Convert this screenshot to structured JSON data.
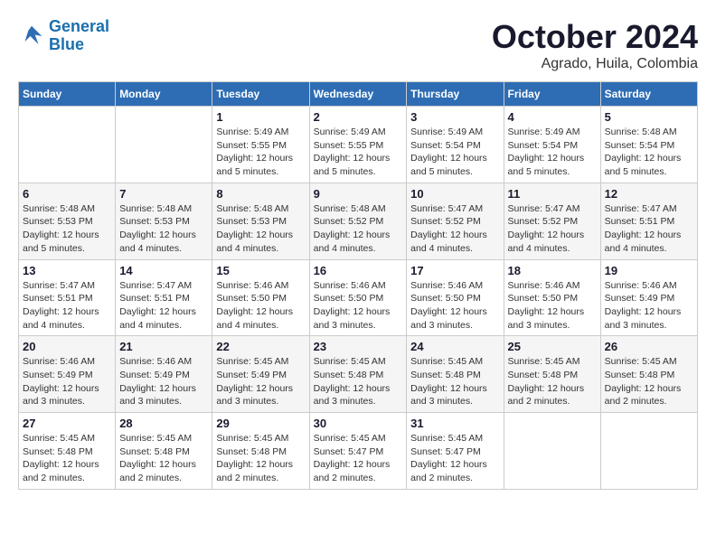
{
  "logo": {
    "line1": "General",
    "line2": "Blue"
  },
  "title": "October 2024",
  "subtitle": "Agrado, Huila, Colombia",
  "days_header": [
    "Sunday",
    "Monday",
    "Tuesday",
    "Wednesday",
    "Thursday",
    "Friday",
    "Saturday"
  ],
  "weeks": [
    [
      {
        "day": "",
        "sunrise": "",
        "sunset": "",
        "daylight": ""
      },
      {
        "day": "",
        "sunrise": "",
        "sunset": "",
        "daylight": ""
      },
      {
        "day": "1",
        "sunrise": "Sunrise: 5:49 AM",
        "sunset": "Sunset: 5:55 PM",
        "daylight": "Daylight: 12 hours and 5 minutes."
      },
      {
        "day": "2",
        "sunrise": "Sunrise: 5:49 AM",
        "sunset": "Sunset: 5:55 PM",
        "daylight": "Daylight: 12 hours and 5 minutes."
      },
      {
        "day": "3",
        "sunrise": "Sunrise: 5:49 AM",
        "sunset": "Sunset: 5:54 PM",
        "daylight": "Daylight: 12 hours and 5 minutes."
      },
      {
        "day": "4",
        "sunrise": "Sunrise: 5:49 AM",
        "sunset": "Sunset: 5:54 PM",
        "daylight": "Daylight: 12 hours and 5 minutes."
      },
      {
        "day": "5",
        "sunrise": "Sunrise: 5:48 AM",
        "sunset": "Sunset: 5:54 PM",
        "daylight": "Daylight: 12 hours and 5 minutes."
      }
    ],
    [
      {
        "day": "6",
        "sunrise": "Sunrise: 5:48 AM",
        "sunset": "Sunset: 5:53 PM",
        "daylight": "Daylight: 12 hours and 5 minutes."
      },
      {
        "day": "7",
        "sunrise": "Sunrise: 5:48 AM",
        "sunset": "Sunset: 5:53 PM",
        "daylight": "Daylight: 12 hours and 4 minutes."
      },
      {
        "day": "8",
        "sunrise": "Sunrise: 5:48 AM",
        "sunset": "Sunset: 5:53 PM",
        "daylight": "Daylight: 12 hours and 4 minutes."
      },
      {
        "day": "9",
        "sunrise": "Sunrise: 5:48 AM",
        "sunset": "Sunset: 5:52 PM",
        "daylight": "Daylight: 12 hours and 4 minutes."
      },
      {
        "day": "10",
        "sunrise": "Sunrise: 5:47 AM",
        "sunset": "Sunset: 5:52 PM",
        "daylight": "Daylight: 12 hours and 4 minutes."
      },
      {
        "day": "11",
        "sunrise": "Sunrise: 5:47 AM",
        "sunset": "Sunset: 5:52 PM",
        "daylight": "Daylight: 12 hours and 4 minutes."
      },
      {
        "day": "12",
        "sunrise": "Sunrise: 5:47 AM",
        "sunset": "Sunset: 5:51 PM",
        "daylight": "Daylight: 12 hours and 4 minutes."
      }
    ],
    [
      {
        "day": "13",
        "sunrise": "Sunrise: 5:47 AM",
        "sunset": "Sunset: 5:51 PM",
        "daylight": "Daylight: 12 hours and 4 minutes."
      },
      {
        "day": "14",
        "sunrise": "Sunrise: 5:47 AM",
        "sunset": "Sunset: 5:51 PM",
        "daylight": "Daylight: 12 hours and 4 minutes."
      },
      {
        "day": "15",
        "sunrise": "Sunrise: 5:46 AM",
        "sunset": "Sunset: 5:50 PM",
        "daylight": "Daylight: 12 hours and 4 minutes."
      },
      {
        "day": "16",
        "sunrise": "Sunrise: 5:46 AM",
        "sunset": "Sunset: 5:50 PM",
        "daylight": "Daylight: 12 hours and 3 minutes."
      },
      {
        "day": "17",
        "sunrise": "Sunrise: 5:46 AM",
        "sunset": "Sunset: 5:50 PM",
        "daylight": "Daylight: 12 hours and 3 minutes."
      },
      {
        "day": "18",
        "sunrise": "Sunrise: 5:46 AM",
        "sunset": "Sunset: 5:50 PM",
        "daylight": "Daylight: 12 hours and 3 minutes."
      },
      {
        "day": "19",
        "sunrise": "Sunrise: 5:46 AM",
        "sunset": "Sunset: 5:49 PM",
        "daylight": "Daylight: 12 hours and 3 minutes."
      }
    ],
    [
      {
        "day": "20",
        "sunrise": "Sunrise: 5:46 AM",
        "sunset": "Sunset: 5:49 PM",
        "daylight": "Daylight: 12 hours and 3 minutes."
      },
      {
        "day": "21",
        "sunrise": "Sunrise: 5:46 AM",
        "sunset": "Sunset: 5:49 PM",
        "daylight": "Daylight: 12 hours and 3 minutes."
      },
      {
        "day": "22",
        "sunrise": "Sunrise: 5:45 AM",
        "sunset": "Sunset: 5:49 PM",
        "daylight": "Daylight: 12 hours and 3 minutes."
      },
      {
        "day": "23",
        "sunrise": "Sunrise: 5:45 AM",
        "sunset": "Sunset: 5:48 PM",
        "daylight": "Daylight: 12 hours and 3 minutes."
      },
      {
        "day": "24",
        "sunrise": "Sunrise: 5:45 AM",
        "sunset": "Sunset: 5:48 PM",
        "daylight": "Daylight: 12 hours and 3 minutes."
      },
      {
        "day": "25",
        "sunrise": "Sunrise: 5:45 AM",
        "sunset": "Sunset: 5:48 PM",
        "daylight": "Daylight: 12 hours and 2 minutes."
      },
      {
        "day": "26",
        "sunrise": "Sunrise: 5:45 AM",
        "sunset": "Sunset: 5:48 PM",
        "daylight": "Daylight: 12 hours and 2 minutes."
      }
    ],
    [
      {
        "day": "27",
        "sunrise": "Sunrise: 5:45 AM",
        "sunset": "Sunset: 5:48 PM",
        "daylight": "Daylight: 12 hours and 2 minutes."
      },
      {
        "day": "28",
        "sunrise": "Sunrise: 5:45 AM",
        "sunset": "Sunset: 5:48 PM",
        "daylight": "Daylight: 12 hours and 2 minutes."
      },
      {
        "day": "29",
        "sunrise": "Sunrise: 5:45 AM",
        "sunset": "Sunset: 5:48 PM",
        "daylight": "Daylight: 12 hours and 2 minutes."
      },
      {
        "day": "30",
        "sunrise": "Sunrise: 5:45 AM",
        "sunset": "Sunset: 5:47 PM",
        "daylight": "Daylight: 12 hours and 2 minutes."
      },
      {
        "day": "31",
        "sunrise": "Sunrise: 5:45 AM",
        "sunset": "Sunset: 5:47 PM",
        "daylight": "Daylight: 12 hours and 2 minutes."
      },
      {
        "day": "",
        "sunrise": "",
        "sunset": "",
        "daylight": ""
      },
      {
        "day": "",
        "sunrise": "",
        "sunset": "",
        "daylight": ""
      }
    ]
  ]
}
